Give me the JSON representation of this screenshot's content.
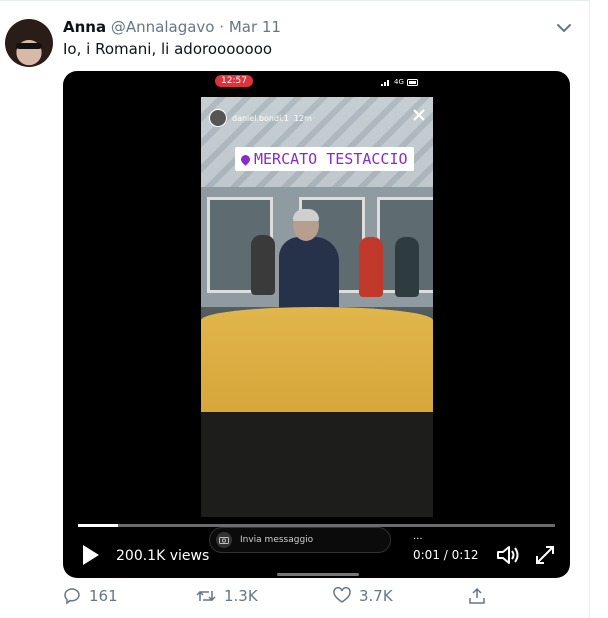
{
  "tweet": {
    "name": "Anna",
    "handle": "@Annalagavo",
    "separator": "·",
    "date": "Mar 11",
    "text": "Io, i Romani, li adorooooooo"
  },
  "video": {
    "phone_time": "12:57",
    "phone_network": "4G",
    "story_user": "daniel.bondi.1",
    "story_age": "12m",
    "location": "MERCATO TESTACCIO",
    "message_placeholder": "Invia messaggio",
    "more": "...",
    "views": "200.1K views",
    "time": "0:01 / 0:12",
    "progress_fraction": 0.083
  },
  "actions": {
    "replies": "161",
    "retweets": "1.3K",
    "likes": "3.7K"
  },
  "colors": {
    "accent_location": "#8a2bc9",
    "time_badge": "#e0313d",
    "secondary_text": "#657786"
  }
}
